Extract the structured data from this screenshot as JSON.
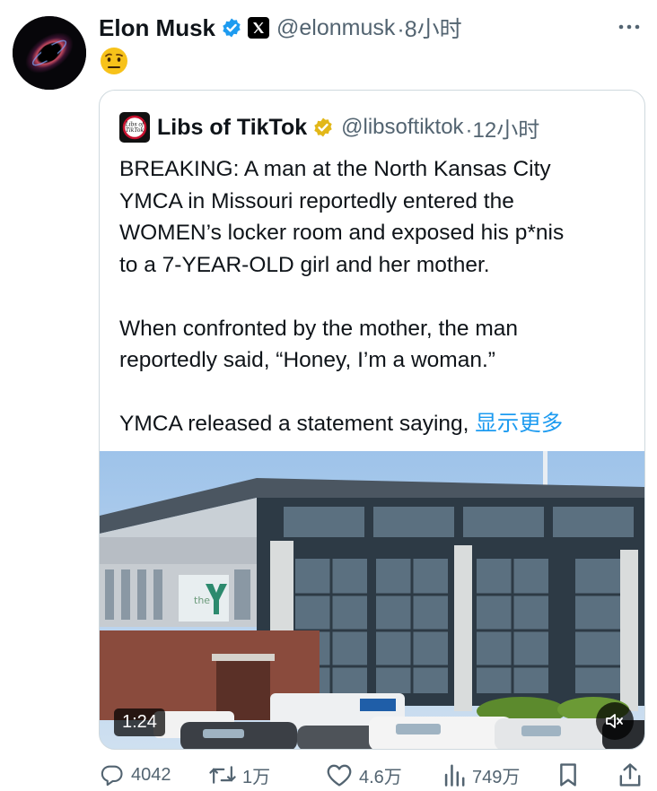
{
  "tweet": {
    "author_name": "Elon Musk",
    "author_handle": "@elonmusk",
    "time": "·8小时",
    "emoji_icon": "face-with-raised-eyebrow-emoji"
  },
  "quoted": {
    "author_name": "Libs of TikTok",
    "author_handle": "@libsoftiktok",
    "time": "·12小时",
    "avatar_text": "Libs of TikTok",
    "text_lines_1": [
      "BREAKING: A man at the North Kansas City",
      "YMCA in Missouri reportedly entered the",
      "WOMEN’s locker room and exposed his p*nis",
      "to a 7-YEAR-OLD girl and her mother."
    ],
    "text_lines_2": [
      "When confronted by the mother, the man",
      "reportedly said, “Honey, I’m a woman.”"
    ],
    "text_line_3": "YMCA released a statement saying,",
    "show_more": "显示更多",
    "video": {
      "duration": "1:24",
      "sign_text": "the"
    }
  },
  "actions": {
    "replies": "4042",
    "reposts": "1万",
    "likes": "4.6万",
    "views": "749万"
  },
  "colors": {
    "verified": "#1d9bf0",
    "gold_verified": "#e2b719",
    "muted_text": "#536471",
    "link": "#1d9bf0"
  }
}
